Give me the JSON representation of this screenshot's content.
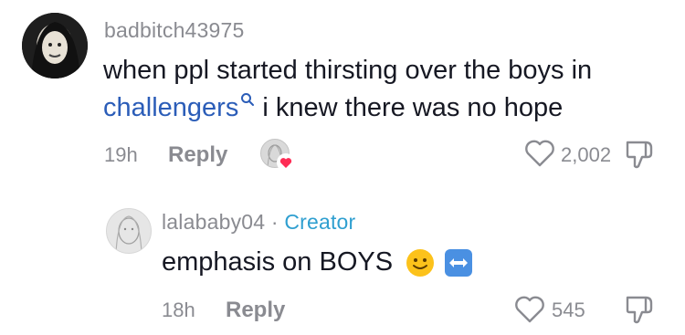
{
  "comment": {
    "username": "badbitch43975",
    "text_line1": "when ppl started thirsting over the boys in",
    "link_text": "challengers",
    "text_line2_rest": " i knew there was no hope",
    "time": "19h",
    "reply_label": "Reply",
    "like_count": "2,002"
  },
  "reply": {
    "username": "lalababy04",
    "separator": " · ",
    "creator_label": "Creator",
    "text": "emphasis on BOYS",
    "time": "18h",
    "reply_label": "Reply",
    "like_count": "545"
  },
  "colors": {
    "link": "#2b5db8",
    "creator": "#2f9fd0",
    "meta_gray": "#8a8b91",
    "heart_badge": "#fe2c55"
  },
  "icons": [
    "search-icon",
    "heart-outline-icon",
    "dislike-icon",
    "heart-badge-icon",
    "slightly-smiling-emoji-icon",
    "left-right-arrow-emoji-icon"
  ]
}
